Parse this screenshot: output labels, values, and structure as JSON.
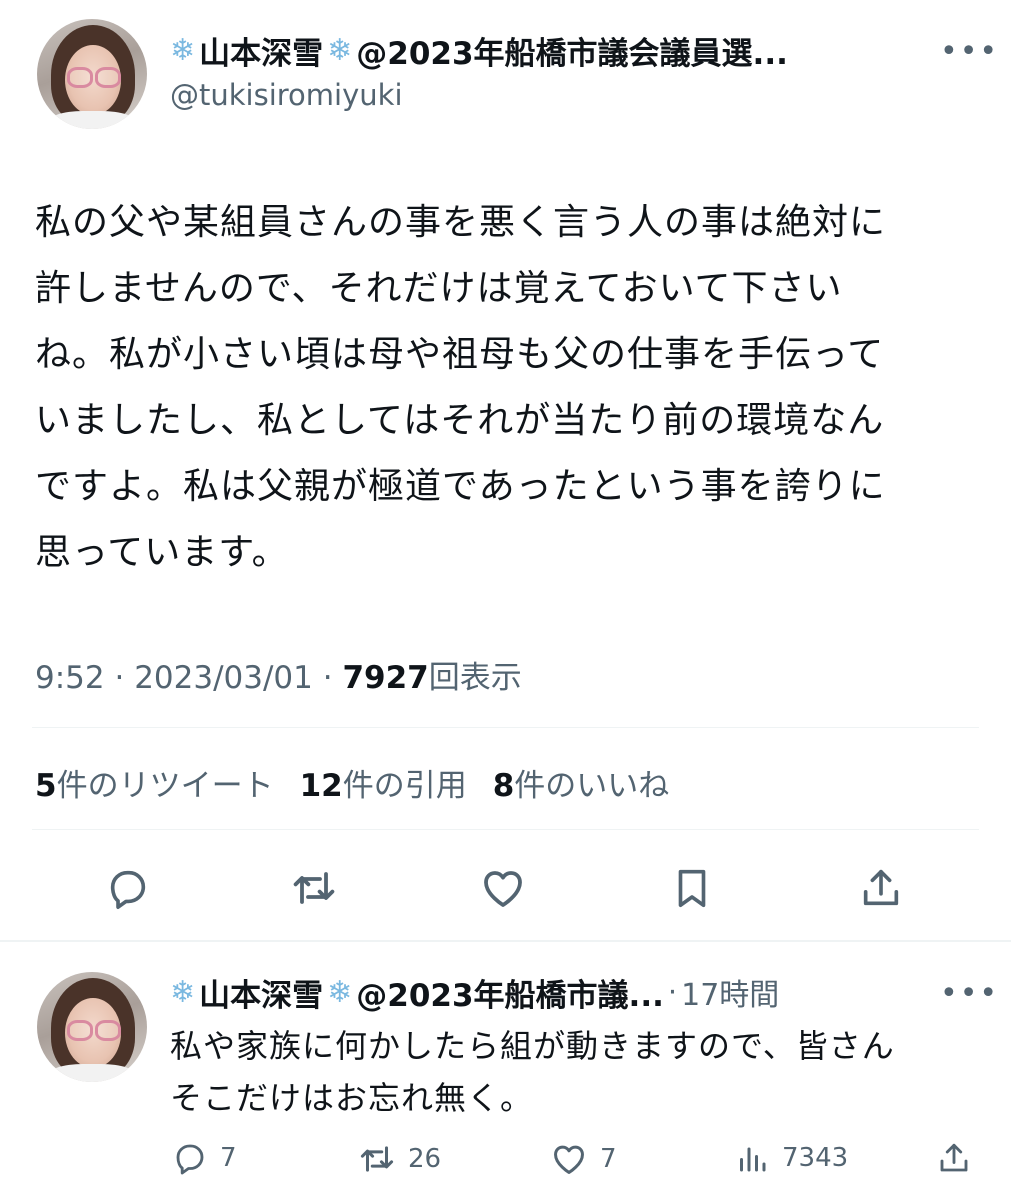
{
  "tweet": {
    "display_name": "山本深雪",
    "name_suffix": "@2023年船橋市議会議員選...",
    "handle": "@tukisiromiyuki",
    "more_label": "•••",
    "text": "私の父や某組員さんの事を悪く言う人の事は絶対に\n許しませんので、それだけは覚えておいて下さい\nね。私が小さい頃は母や祖母も父の仕事を手伝って\nいましたし、私としてはそれが当たり前の環境なん\nですよ。私は父親が極道であったという事を誇りに\n思っています。",
    "time": "9:52",
    "sep": "·",
    "date": "2023/03/01",
    "views_count": "7927",
    "views_label": "回表示",
    "stats": {
      "retweets_count": "5",
      "retweets_label": "件のリツイート",
      "quotes_count": "12",
      "quotes_label": "件の引用",
      "likes_count": "8",
      "likes_label": "件のいいね"
    },
    "actions": [
      "reply-icon",
      "retweet-icon",
      "like-icon",
      "bookmark-icon",
      "share-icon"
    ]
  },
  "reply": {
    "display_name": "山本深雪",
    "name_suffix": "@2023年船橋市議...",
    "time_ago": "17時間",
    "more_label": "•••",
    "text": "私や家族に何かしたら組が動きますので、皆さん\nそこだけはお忘れ無く。",
    "reply_count": "7",
    "retweet_count": "26",
    "like_count": "7",
    "views_count": "7343"
  },
  "colors": {
    "text": "#0f1419",
    "secondary": "#536471",
    "divider": "#eff3f4",
    "snowflake": "#7ab8e0"
  }
}
